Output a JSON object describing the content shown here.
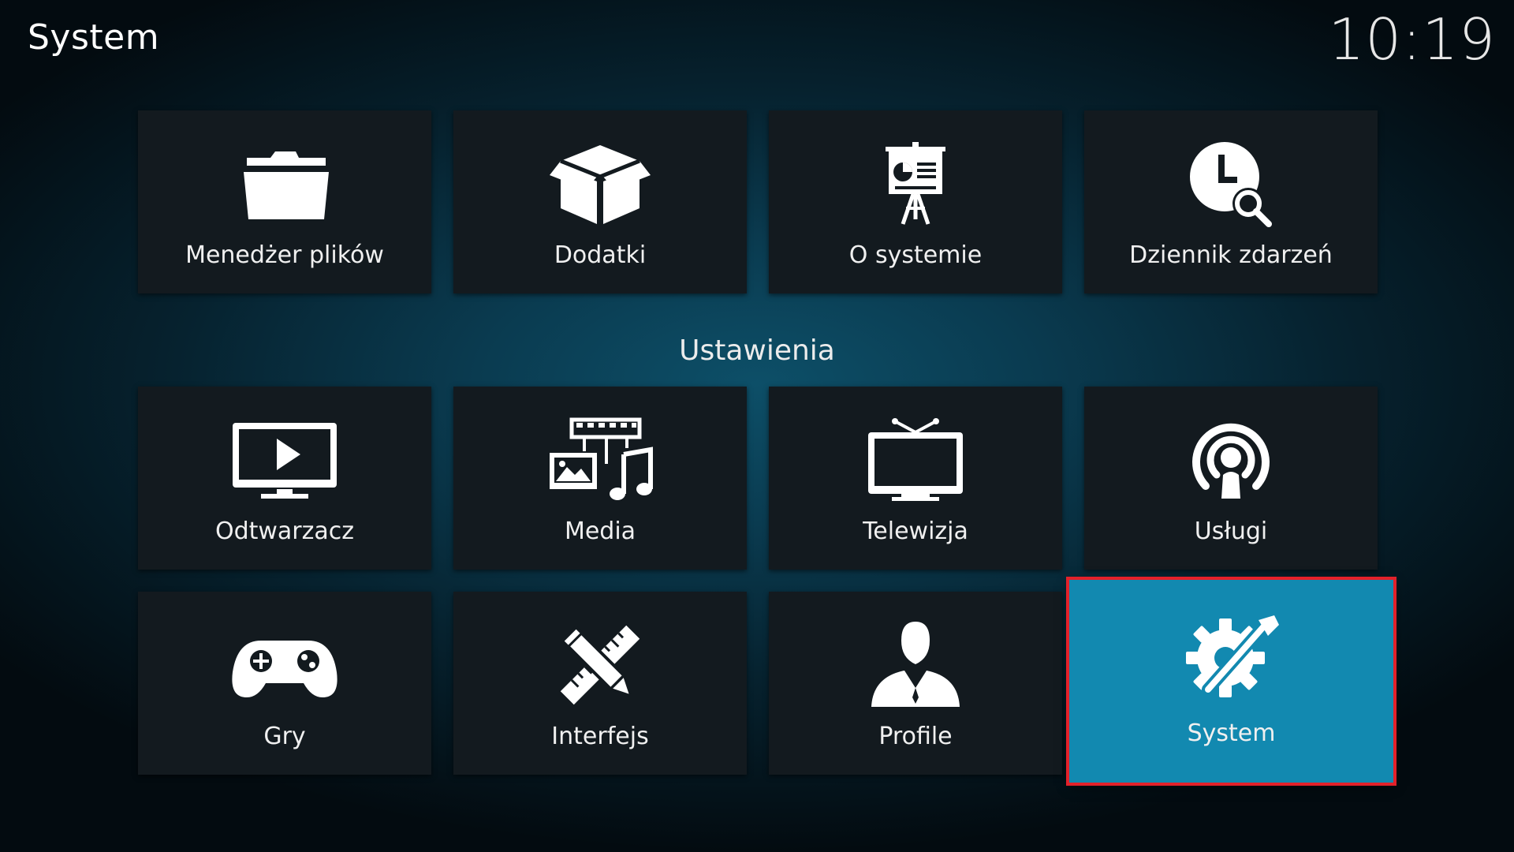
{
  "header": {
    "title": "System",
    "clock": "10:19"
  },
  "top_row": [
    {
      "label": "Menedżer plików",
      "icon": "folder-icon"
    },
    {
      "label": "Dodatki",
      "icon": "open-box-icon"
    },
    {
      "label": "O systemie",
      "icon": "presentation-board-icon"
    },
    {
      "label": "Dziennik zdarzeń",
      "icon": "clock-search-icon"
    }
  ],
  "section": {
    "title": "Ustawienia"
  },
  "settings": [
    {
      "label": "Odtwarzacz",
      "icon": "monitor-play-icon"
    },
    {
      "label": "Media",
      "icon": "media-icon"
    },
    {
      "label": "Telewizja",
      "icon": "tv-icon"
    },
    {
      "label": "Usługi",
      "icon": "broadcast-icon"
    },
    {
      "label": "Gry",
      "icon": "gamepad-icon"
    },
    {
      "label": "Interfejs",
      "icon": "pencil-ruler-icon"
    },
    {
      "label": "Profile",
      "icon": "user-silhouette-icon"
    },
    {
      "label": "System",
      "icon": "gear-screwdriver-icon"
    }
  ],
  "colors": {
    "focus_fill": "#1289b0",
    "focus_outline": "#e3212a",
    "tile": "#131a1f"
  }
}
